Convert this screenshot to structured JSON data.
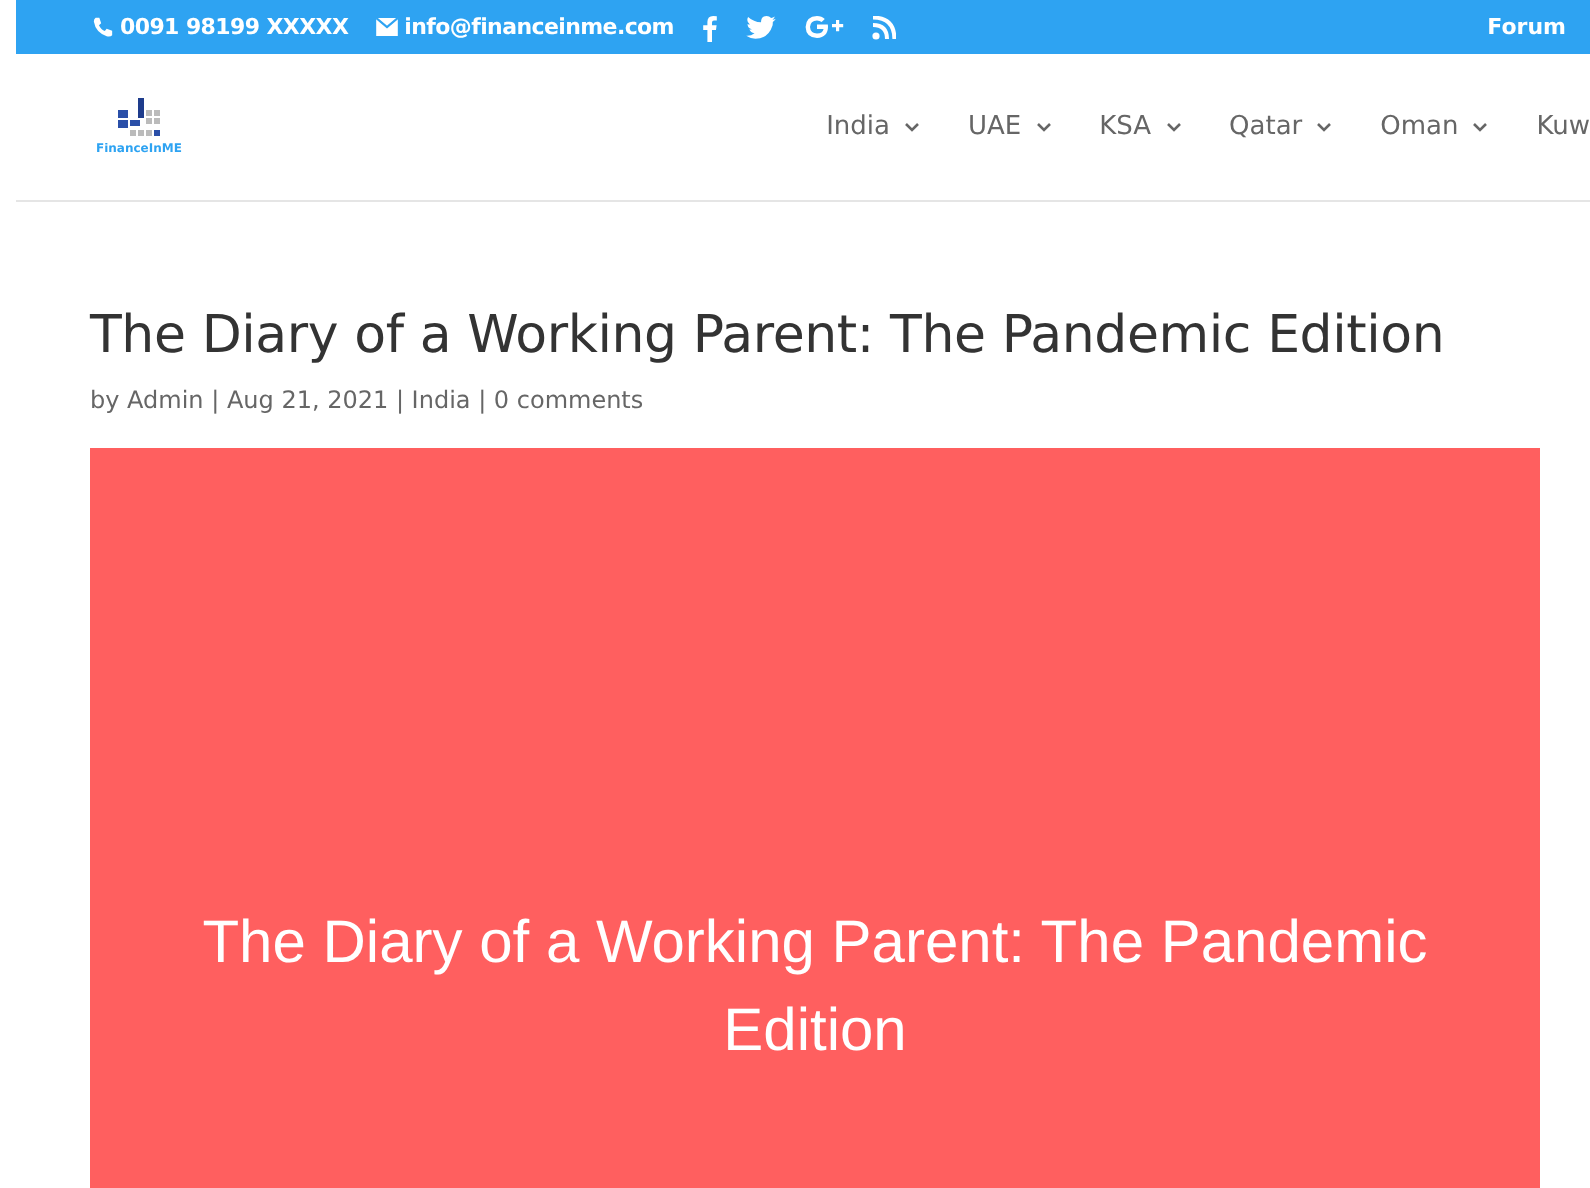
{
  "top_bar": {
    "phone": "0091 98199 XXXXX",
    "email": "info@financeinme.com",
    "social": [
      {
        "kind": "facebook"
      },
      {
        "kind": "twitter"
      },
      {
        "kind": "googleplus"
      },
      {
        "kind": "rss"
      }
    ],
    "links": [
      "Forum"
    ]
  },
  "header": {
    "logo_text": "FinanceInME",
    "nav": [
      {
        "label": "India",
        "dropdown": true
      },
      {
        "label": "UAE",
        "dropdown": true
      },
      {
        "label": "KSA",
        "dropdown": true
      },
      {
        "label": "Qatar",
        "dropdown": true
      },
      {
        "label": "Oman",
        "dropdown": true
      },
      {
        "label": "Kuw",
        "dropdown": false
      }
    ]
  },
  "post": {
    "title": "The Diary of a Working Parent: The Pandemic Edition",
    "meta": "by Admin | Aug 21, 2021 | India | 0 comments",
    "banner_text": "The Diary of a Working Parent: The Pandemic Edition"
  }
}
